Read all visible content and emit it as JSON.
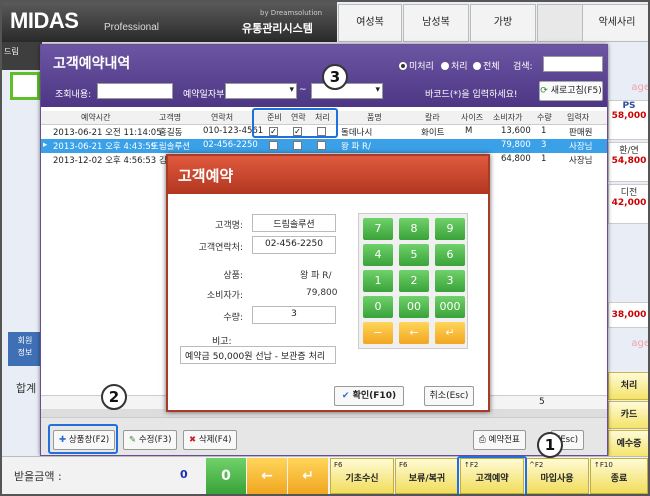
{
  "app": {
    "logo": "MIDAS",
    "logo_sub": "Professional",
    "byline": "by Dreamsolution",
    "brand": "유통관리시스템"
  },
  "categories": [
    "여성복",
    "남성복",
    "가방",
    "악세사리"
  ],
  "left_strip": {
    "text": "드림",
    "member_tab": "회원\n정보",
    "sum_label": "합계"
  },
  "right_column": {
    "items": [
      {
        "label": "PS",
        "value": "58,000"
      },
      {
        "label": "환/연",
        "value": "54,800"
      },
      {
        "label": "디전",
        "value": "42,000"
      },
      {
        "label": "",
        "value": "38,000"
      }
    ],
    "tags": [
      "age",
      "age"
    ],
    "buttons": [
      "처리",
      "카드",
      "예수증"
    ]
  },
  "dialog": {
    "title": "고객예약내역",
    "filters": {
      "radios": [
        {
          "label": "미처리",
          "selected": true
        },
        {
          "label": "처리",
          "selected": false
        },
        {
          "label": "전체",
          "selected": false
        }
      ],
      "search_label": "검색:",
      "lookup_label": "조회내용:",
      "date_label": "예약일자부:",
      "barcode_hint": "바코드(*)을 입력하세요!",
      "refresh_button": "새로고침(F5)"
    },
    "columns": [
      "예약시간",
      "고객명",
      "연락처",
      "준비",
      "연락",
      "처리",
      "품명",
      "칼라",
      "사이즈",
      "소비자가",
      "수량",
      "입력자"
    ],
    "rows": [
      {
        "time": "2013-06-21 오전 11:14:05",
        "name": "홍길동",
        "phone": "010-123-4561",
        "prep": true,
        "contact": true,
        "done": false,
        "item": "돌데나시",
        "color": "화이트",
        "size": "M",
        "price": "13,600",
        "qty": "1",
        "user": "판매원",
        "selected": false
      },
      {
        "time": "2013-06-21 오후 4:43:59",
        "name": "드림솔루션",
        "phone": "02-456-2250",
        "prep": false,
        "contact": false,
        "done": false,
        "item": "왕 파 R/",
        "color": "",
        "size": "",
        "price": "79,800",
        "qty": "3",
        "user": "사장님",
        "selected": true
      },
      {
        "time": "2013-12-02 오후 4:56:53",
        "name": "김",
        "phone": "",
        "prep": false,
        "contact": false,
        "done": false,
        "item": "",
        "color": "",
        "size": "",
        "price": "64,800",
        "qty": "1",
        "user": "사장님",
        "selected": false
      }
    ],
    "footer_count": "5",
    "buttons": {
      "detail": "상품창(F2)",
      "edit": "수정(F3)",
      "delete": "삭제(F4)",
      "print": "예약전표",
      "close": "(Esc)"
    }
  },
  "reserve_dialog": {
    "title": "고객예약",
    "customer_label": "고객명:",
    "customer_value": "드림솔루션",
    "phone_label": "고객연락처:",
    "phone_value": "02-456-2250",
    "product_label": "상품:",
    "product_value": "왕 파 R/",
    "price_label": "소비자가:",
    "price_value": "79,800",
    "qty_label": "수량:",
    "qty_value": "3",
    "note_label": "비고:",
    "note_value": "예약금 50,000원 선납 - 보관증 처리",
    "keypad": [
      "7",
      "8",
      "9",
      "4",
      "5",
      "6",
      "1",
      "2",
      "3",
      "0",
      "00",
      "000",
      "−",
      "←",
      "↵"
    ],
    "ok_button": "확인(F10)",
    "cancel_button": "취소(Esc)"
  },
  "bottom_bar": {
    "paid_label": "받을금액 :",
    "paid_value": "0",
    "green_key": "0",
    "yellow_keys": [
      "←",
      "↵"
    ],
    "fkeys": [
      {
        "key": "F6",
        "label": "기초수신"
      },
      {
        "key": "F6",
        "label": "보류/복귀"
      },
      {
        "key": "↑F2",
        "label": "고객예약"
      },
      {
        "key": "^F2",
        "label": "마입사용"
      },
      {
        "key": "↑F10",
        "label": "종료"
      }
    ]
  },
  "callouts": [
    "1",
    "2",
    "3"
  ]
}
